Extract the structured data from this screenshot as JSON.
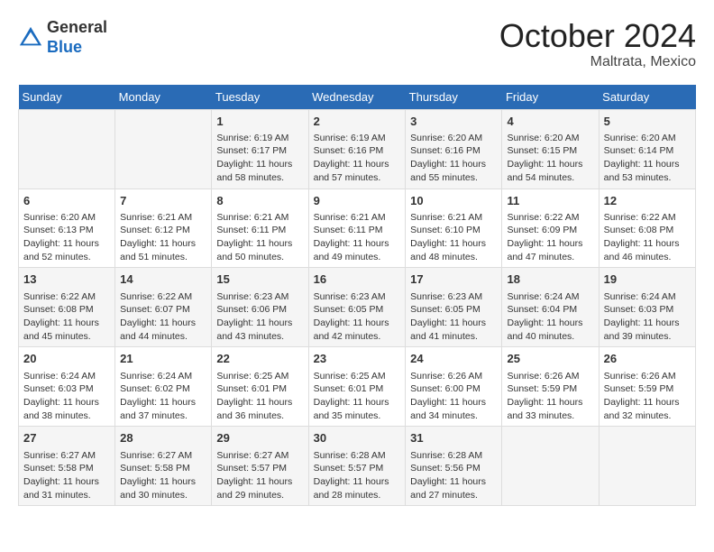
{
  "header": {
    "logo_line1": "General",
    "logo_line2": "Blue",
    "month": "October 2024",
    "location": "Maltrata, Mexico"
  },
  "days_of_week": [
    "Sunday",
    "Monday",
    "Tuesday",
    "Wednesday",
    "Thursday",
    "Friday",
    "Saturday"
  ],
  "weeks": [
    [
      {
        "day": "",
        "content": ""
      },
      {
        "day": "",
        "content": ""
      },
      {
        "day": "1",
        "content": "Sunrise: 6:19 AM\nSunset: 6:17 PM\nDaylight: 11 hours and 58 minutes."
      },
      {
        "day": "2",
        "content": "Sunrise: 6:19 AM\nSunset: 6:16 PM\nDaylight: 11 hours and 57 minutes."
      },
      {
        "day": "3",
        "content": "Sunrise: 6:20 AM\nSunset: 6:16 PM\nDaylight: 11 hours and 55 minutes."
      },
      {
        "day": "4",
        "content": "Sunrise: 6:20 AM\nSunset: 6:15 PM\nDaylight: 11 hours and 54 minutes."
      },
      {
        "day": "5",
        "content": "Sunrise: 6:20 AM\nSunset: 6:14 PM\nDaylight: 11 hours and 53 minutes."
      }
    ],
    [
      {
        "day": "6",
        "content": "Sunrise: 6:20 AM\nSunset: 6:13 PM\nDaylight: 11 hours and 52 minutes."
      },
      {
        "day": "7",
        "content": "Sunrise: 6:21 AM\nSunset: 6:12 PM\nDaylight: 11 hours and 51 minutes."
      },
      {
        "day": "8",
        "content": "Sunrise: 6:21 AM\nSunset: 6:11 PM\nDaylight: 11 hours and 50 minutes."
      },
      {
        "day": "9",
        "content": "Sunrise: 6:21 AM\nSunset: 6:11 PM\nDaylight: 11 hours and 49 minutes."
      },
      {
        "day": "10",
        "content": "Sunrise: 6:21 AM\nSunset: 6:10 PM\nDaylight: 11 hours and 48 minutes."
      },
      {
        "day": "11",
        "content": "Sunrise: 6:22 AM\nSunset: 6:09 PM\nDaylight: 11 hours and 47 minutes."
      },
      {
        "day": "12",
        "content": "Sunrise: 6:22 AM\nSunset: 6:08 PM\nDaylight: 11 hours and 46 minutes."
      }
    ],
    [
      {
        "day": "13",
        "content": "Sunrise: 6:22 AM\nSunset: 6:08 PM\nDaylight: 11 hours and 45 minutes."
      },
      {
        "day": "14",
        "content": "Sunrise: 6:22 AM\nSunset: 6:07 PM\nDaylight: 11 hours and 44 minutes."
      },
      {
        "day": "15",
        "content": "Sunrise: 6:23 AM\nSunset: 6:06 PM\nDaylight: 11 hours and 43 minutes."
      },
      {
        "day": "16",
        "content": "Sunrise: 6:23 AM\nSunset: 6:05 PM\nDaylight: 11 hours and 42 minutes."
      },
      {
        "day": "17",
        "content": "Sunrise: 6:23 AM\nSunset: 6:05 PM\nDaylight: 11 hours and 41 minutes."
      },
      {
        "day": "18",
        "content": "Sunrise: 6:24 AM\nSunset: 6:04 PM\nDaylight: 11 hours and 40 minutes."
      },
      {
        "day": "19",
        "content": "Sunrise: 6:24 AM\nSunset: 6:03 PM\nDaylight: 11 hours and 39 minutes."
      }
    ],
    [
      {
        "day": "20",
        "content": "Sunrise: 6:24 AM\nSunset: 6:03 PM\nDaylight: 11 hours and 38 minutes."
      },
      {
        "day": "21",
        "content": "Sunrise: 6:24 AM\nSunset: 6:02 PM\nDaylight: 11 hours and 37 minutes."
      },
      {
        "day": "22",
        "content": "Sunrise: 6:25 AM\nSunset: 6:01 PM\nDaylight: 11 hours and 36 minutes."
      },
      {
        "day": "23",
        "content": "Sunrise: 6:25 AM\nSunset: 6:01 PM\nDaylight: 11 hours and 35 minutes."
      },
      {
        "day": "24",
        "content": "Sunrise: 6:26 AM\nSunset: 6:00 PM\nDaylight: 11 hours and 34 minutes."
      },
      {
        "day": "25",
        "content": "Sunrise: 6:26 AM\nSunset: 5:59 PM\nDaylight: 11 hours and 33 minutes."
      },
      {
        "day": "26",
        "content": "Sunrise: 6:26 AM\nSunset: 5:59 PM\nDaylight: 11 hours and 32 minutes."
      }
    ],
    [
      {
        "day": "27",
        "content": "Sunrise: 6:27 AM\nSunset: 5:58 PM\nDaylight: 11 hours and 31 minutes."
      },
      {
        "day": "28",
        "content": "Sunrise: 6:27 AM\nSunset: 5:58 PM\nDaylight: 11 hours and 30 minutes."
      },
      {
        "day": "29",
        "content": "Sunrise: 6:27 AM\nSunset: 5:57 PM\nDaylight: 11 hours and 29 minutes."
      },
      {
        "day": "30",
        "content": "Sunrise: 6:28 AM\nSunset: 5:57 PM\nDaylight: 11 hours and 28 minutes."
      },
      {
        "day": "31",
        "content": "Sunrise: 6:28 AM\nSunset: 5:56 PM\nDaylight: 11 hours and 27 minutes."
      },
      {
        "day": "",
        "content": ""
      },
      {
        "day": "",
        "content": ""
      }
    ]
  ]
}
